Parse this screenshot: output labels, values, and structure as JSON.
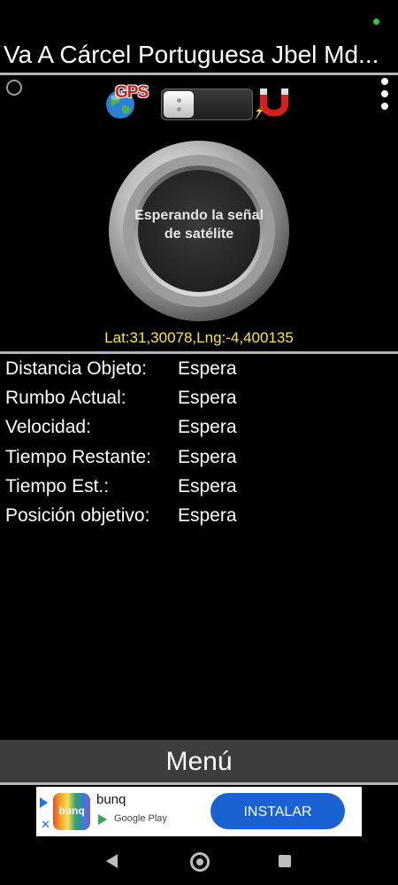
{
  "app": {
    "title": "Va A Cárcel Portuguesa Jbel Md..."
  },
  "toolbar": {
    "gps_label": "GPS",
    "icons": [
      "ring-icon",
      "globe-icon",
      "toggle-switch",
      "magnet-icon",
      "overflow-menu-icon"
    ]
  },
  "dial": {
    "status": "Esperando la señal de satélite"
  },
  "coords": "Lat:31,30078,Lng:-4,400135",
  "info": [
    {
      "label": "Distancia Objeto:",
      "value": "Espera"
    },
    {
      "label": "Rumbo Actual:",
      "value": "Espera"
    },
    {
      "label": "Velocidad:",
      "value": "Espera"
    },
    {
      "label": "Tiempo Restante:",
      "value": "Espera"
    },
    {
      "label": "Tiempo Est.:",
      "value": "Espera"
    },
    {
      "label": "Posición objetivo:",
      "value": "Espera"
    }
  ],
  "menu": {
    "label": "Menú"
  },
  "ad": {
    "app_name": "bunq",
    "logo_text": "bunq",
    "store": "Google Play",
    "button": "INSTALAR"
  },
  "colors": {
    "coords": "#ffe73b",
    "ad_button": "#1a62d1",
    "status_dot": "#2ecc40"
  }
}
